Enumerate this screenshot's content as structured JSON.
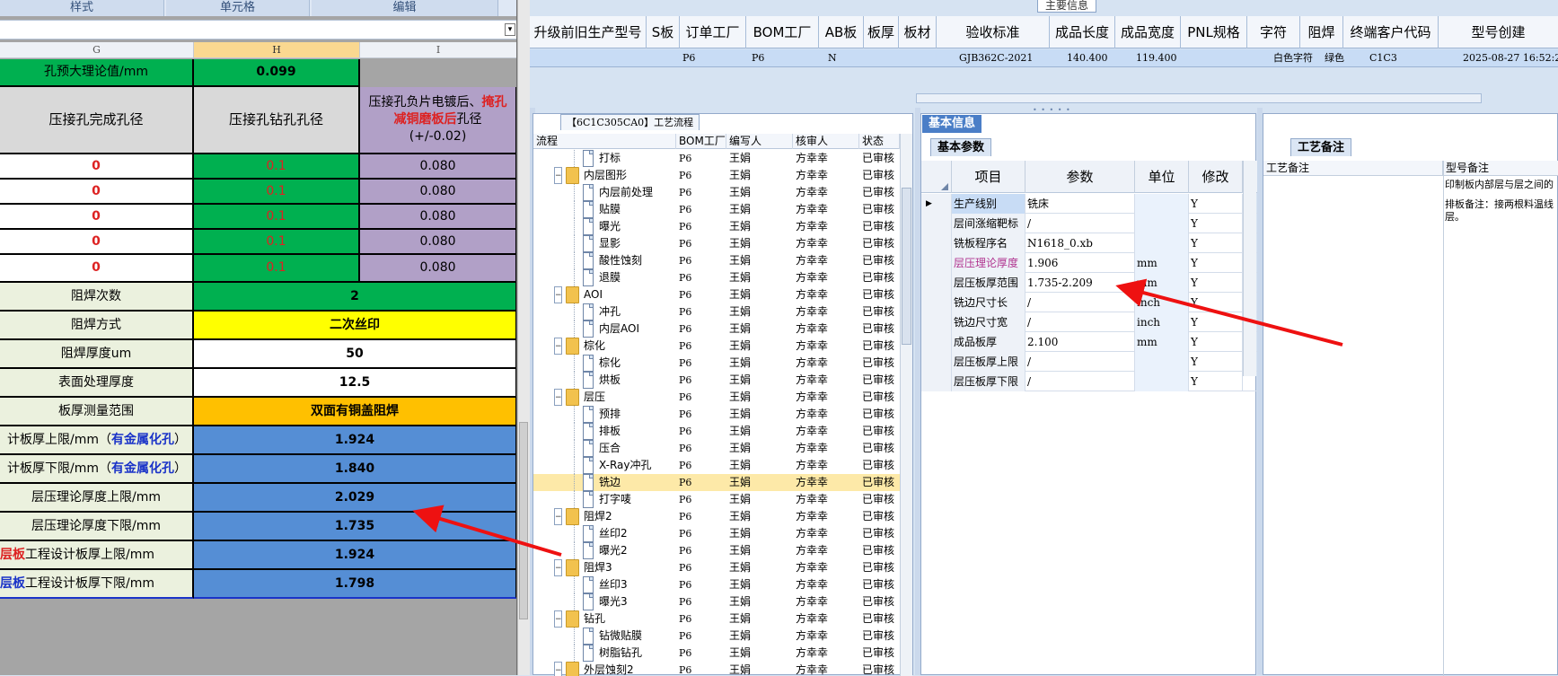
{
  "ribbon": {
    "groups": [
      "样式",
      "单元格",
      "编辑"
    ]
  },
  "sheet": {
    "columns": [
      "G",
      "H",
      "I"
    ],
    "rows": [
      {
        "g": "孔预大理论值/mm",
        "h": "0.099",
        "i": ""
      },
      {
        "g": "压接孔完成孔径",
        "h": "压接孔钻孔孔径",
        "i_parts": [
          "压接孔负片电镀后、",
          "掩孔",
          "减铜磨板后",
          "孔径",
          "(+/-0.02)"
        ]
      },
      {
        "g": "0",
        "h": "0.1",
        "i": "0.080"
      },
      {
        "g": "0",
        "h": "0.1",
        "i": "0.080"
      },
      {
        "g": "0",
        "h": "0.1",
        "i": "0.080"
      },
      {
        "g": "0",
        "h": "0.1",
        "i": "0.080"
      },
      {
        "g": "0",
        "h": "0.1",
        "i": "0.080"
      },
      {
        "g": "阻焊次数",
        "h": "2"
      },
      {
        "g": "阻焊方式",
        "h": "二次丝印"
      },
      {
        "g": "阻焊厚度um",
        "h": "50"
      },
      {
        "g": "表面处理厚度",
        "h": "12.5"
      },
      {
        "g": "板厚测量范围",
        "h": "双面有铜盖阻焊"
      },
      {
        "g_parts": [
          "计板厚上限/mm（",
          "有金属化孔",
          "）"
        ],
        "h": "1.924"
      },
      {
        "g_parts": [
          "计板厚下限/mm（",
          "有金属化孔",
          "）"
        ],
        "h": "1.840"
      },
      {
        "g": "层压理论厚度上限/mm",
        "h": "2.029"
      },
      {
        "g": "层压理论厚度下限/mm",
        "h": "1.735"
      },
      {
        "g_parts": [
          "层板",
          "工程设计板厚上限/mm"
        ],
        "h": "1.924"
      },
      {
        "g_parts": [
          "层板",
          "工程设计板厚下限/mm"
        ],
        "h": "1.798"
      }
    ]
  },
  "main_info": {
    "label": "主要信息",
    "headers": [
      "升级前旧生产型号",
      "S板",
      "订单工厂",
      "BOM工厂",
      "AB板",
      "板厚",
      "板材",
      "验收标准",
      "成品长度",
      "成品宽度",
      "PNL规格",
      "字符",
      "阻焊",
      "终端客户代码",
      "型号创建"
    ],
    "row": [
      "",
      "",
      "P6",
      "P6",
      "N",
      "",
      "",
      "GJB362C-2021",
      "140.400",
      "119.400",
      "",
      "白色字符",
      "绿色",
      "C1C3",
      "2025-08-27 16:52:2"
    ]
  },
  "flow": {
    "tab": "【6C1C305CA0】工艺流程",
    "headers": [
      "流程",
      "BOM工厂",
      "编写人",
      "核审人",
      "状态"
    ],
    "rows": [
      {
        "name": "打标",
        "level": 2,
        "type": "file",
        "bom": "P6",
        "author": "王娟",
        "reviewer": "方幸幸",
        "status": "已审核"
      },
      {
        "name": "内层图形",
        "level": 1,
        "type": "folder",
        "bom": "P6",
        "author": "王娟",
        "reviewer": "方幸幸",
        "status": "已审核"
      },
      {
        "name": "内层前处理",
        "level": 2,
        "type": "file",
        "bom": "P6",
        "author": "王娟",
        "reviewer": "方幸幸",
        "status": "已审核"
      },
      {
        "name": "贴膜",
        "level": 2,
        "type": "file",
        "bom": "P6",
        "author": "王娟",
        "reviewer": "方幸幸",
        "status": "已审核"
      },
      {
        "name": "曝光",
        "level": 2,
        "type": "file",
        "bom": "P6",
        "author": "王娟",
        "reviewer": "方幸幸",
        "status": "已审核"
      },
      {
        "name": "显影",
        "level": 2,
        "type": "file",
        "bom": "P6",
        "author": "王娟",
        "reviewer": "方幸幸",
        "status": "已审核"
      },
      {
        "name": "酸性蚀刻",
        "level": 2,
        "type": "file",
        "bom": "P6",
        "author": "王娟",
        "reviewer": "方幸幸",
        "status": "已审核"
      },
      {
        "name": "退膜",
        "level": 2,
        "type": "file",
        "bom": "P6",
        "author": "王娟",
        "reviewer": "方幸幸",
        "status": "已审核"
      },
      {
        "name": "AOI",
        "level": 1,
        "type": "folder",
        "bom": "P6",
        "author": "王娟",
        "reviewer": "方幸幸",
        "status": "已审核"
      },
      {
        "name": "冲孔",
        "level": 2,
        "type": "file",
        "bom": "P6",
        "author": "王娟",
        "reviewer": "方幸幸",
        "status": "已审核"
      },
      {
        "name": "内层AOI",
        "level": 2,
        "type": "file",
        "bom": "P6",
        "author": "王娟",
        "reviewer": "方幸幸",
        "status": "已审核"
      },
      {
        "name": "棕化",
        "level": 1,
        "type": "folder",
        "bom": "P6",
        "author": "王娟",
        "reviewer": "方幸幸",
        "status": "已审核"
      },
      {
        "name": "棕化",
        "level": 2,
        "type": "file",
        "bom": "P6",
        "author": "王娟",
        "reviewer": "方幸幸",
        "status": "已审核"
      },
      {
        "name": "烘板",
        "level": 2,
        "type": "file",
        "bom": "P6",
        "author": "王娟",
        "reviewer": "方幸幸",
        "status": "已审核"
      },
      {
        "name": "层压",
        "level": 1,
        "type": "folder",
        "bom": "P6",
        "author": "王娟",
        "reviewer": "方幸幸",
        "status": "已审核"
      },
      {
        "name": "预排",
        "level": 2,
        "type": "file",
        "bom": "P6",
        "author": "王娟",
        "reviewer": "方幸幸",
        "status": "已审核"
      },
      {
        "name": "排板",
        "level": 2,
        "type": "file",
        "bom": "P6",
        "author": "王娟",
        "reviewer": "方幸幸",
        "status": "已审核"
      },
      {
        "name": "压合",
        "level": 2,
        "type": "file",
        "bom": "P6",
        "author": "王娟",
        "reviewer": "方幸幸",
        "status": "已审核"
      },
      {
        "name": "X-Ray冲孔",
        "level": 2,
        "type": "file",
        "bom": "P6",
        "author": "王娟",
        "reviewer": "方幸幸",
        "status": "已审核"
      },
      {
        "name": "铣边",
        "level": 2,
        "type": "file",
        "bom": "P6",
        "author": "王娟",
        "reviewer": "方幸幸",
        "status": "已审核",
        "selected": true
      },
      {
        "name": "打字唛",
        "level": 2,
        "type": "file",
        "bom": "P6",
        "author": "王娟",
        "reviewer": "方幸幸",
        "status": "已审核"
      },
      {
        "name": "阻焊2",
        "level": 1,
        "type": "folder",
        "bom": "P6",
        "author": "王娟",
        "reviewer": "方幸幸",
        "status": "已审核"
      },
      {
        "name": "丝印2",
        "level": 2,
        "type": "file",
        "bom": "P6",
        "author": "王娟",
        "reviewer": "方幸幸",
        "status": "已审核"
      },
      {
        "name": "曝光2",
        "level": 2,
        "type": "file",
        "bom": "P6",
        "author": "王娟",
        "reviewer": "方幸幸",
        "status": "已审核"
      },
      {
        "name": "阻焊3",
        "level": 1,
        "type": "folder",
        "bom": "P6",
        "author": "王娟",
        "reviewer": "方幸幸",
        "status": "已审核"
      },
      {
        "name": "丝印3",
        "level": 2,
        "type": "file",
        "bom": "P6",
        "author": "王娟",
        "reviewer": "方幸幸",
        "status": "已审核"
      },
      {
        "name": "曝光3",
        "level": 2,
        "type": "file",
        "bom": "P6",
        "author": "王娟",
        "reviewer": "方幸幸",
        "status": "已审核"
      },
      {
        "name": "钻孔",
        "level": 1,
        "type": "folder",
        "bom": "P6",
        "author": "王娟",
        "reviewer": "方幸幸",
        "status": "已审核"
      },
      {
        "name": "钻微贴膜",
        "level": 2,
        "type": "file",
        "bom": "P6",
        "author": "王娟",
        "reviewer": "方幸幸",
        "status": "已审核"
      },
      {
        "name": "树脂钻孔",
        "level": 2,
        "type": "file",
        "bom": "P6",
        "author": "王娟",
        "reviewer": "方幸幸",
        "status": "已审核"
      },
      {
        "name": "外层蚀刻2",
        "level": 1,
        "type": "folder",
        "bom": "P6",
        "author": "王娟",
        "reviewer": "方幸幸",
        "status": "已审核"
      }
    ]
  },
  "basic": {
    "tab": "基本信息",
    "subtab": "基本参数",
    "headers": [
      "项目",
      "参数",
      "单位",
      "修改"
    ],
    "rows": [
      {
        "item": "生产线别",
        "value": "铣床",
        "unit": "",
        "mod": "Y",
        "current": true
      },
      {
        "item": "层间涨缩靶标",
        "value": "/",
        "unit": "",
        "mod": "Y"
      },
      {
        "item": "铣板程序名",
        "value": "N1618_0.xb",
        "unit": "",
        "mod": "Y"
      },
      {
        "item": "层压理论厚度",
        "value": "1.906",
        "unit": "mm",
        "mod": "Y",
        "highlight": true
      },
      {
        "item": "层压板厚范围",
        "value": "1.735-2.209",
        "unit": "mm",
        "mod": "Y"
      },
      {
        "item": "铣边尺寸长",
        "value": "/",
        "unit": "inch",
        "mod": "Y"
      },
      {
        "item": "铣边尺寸宽",
        "value": "/",
        "unit": "inch",
        "mod": "Y"
      },
      {
        "item": "成品板厚",
        "value": "2.100",
        "unit": "mm",
        "mod": "Y"
      },
      {
        "item": "层压板厚上限",
        "value": "/",
        "unit": "",
        "mod": "Y"
      },
      {
        "item": "层压板厚下限",
        "value": "/",
        "unit": "",
        "mod": "Y"
      }
    ]
  },
  "memo": {
    "tab": "工艺备注",
    "headers": [
      "工艺备注",
      "型号备注"
    ],
    "text1": "印制板内部层与层之间的",
    "text2": "排板备注：接两根料温线",
    "text3": "层。"
  },
  "colors": {
    "green": "#00b050",
    "yellow": "#ffff00",
    "orange": "#ffc000",
    "blue": "#558ed5",
    "lavender": "#b1a0c7",
    "grey": "#d9d9d9",
    "pale": "#ebf1de",
    "arrow": "#ee1111"
  }
}
